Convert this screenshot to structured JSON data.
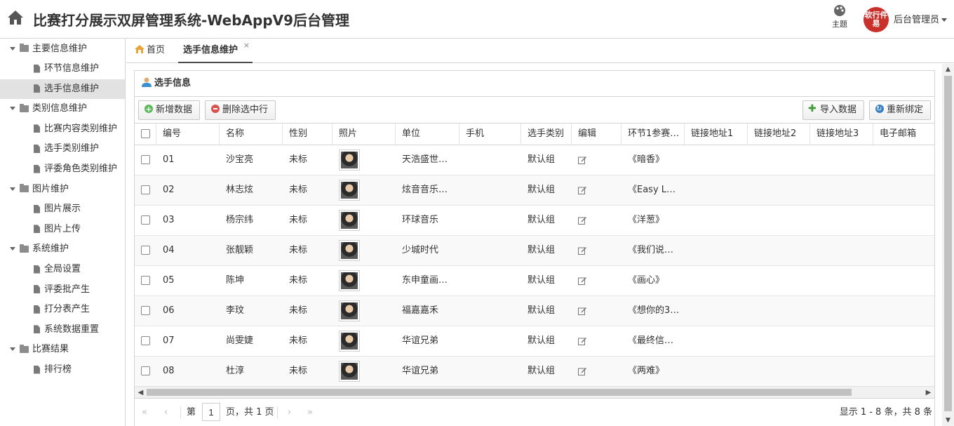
{
  "header": {
    "title": "比赛打分展示双屏管理系统-WebAppV9后台管理",
    "theme_label": "主题",
    "user_name": "后台管理员",
    "avatar_text": "软行件易"
  },
  "sidebar": {
    "groups": [
      {
        "label": "主要信息维护",
        "items": [
          {
            "label": "环节信息维护"
          },
          {
            "label": "选手信息维护",
            "selected": true
          }
        ]
      },
      {
        "label": "类别信息维护",
        "items": [
          {
            "label": "比赛内容类别维护"
          },
          {
            "label": "选手类别维护"
          },
          {
            "label": "评委角色类别维护"
          }
        ]
      },
      {
        "label": "图片维护",
        "items": [
          {
            "label": "图片展示"
          },
          {
            "label": "图片上传"
          }
        ]
      },
      {
        "label": "系统维护",
        "items": [
          {
            "label": "全局设置"
          },
          {
            "label": "评委批产生"
          },
          {
            "label": "打分表产生"
          },
          {
            "label": "系统数据重置"
          }
        ]
      },
      {
        "label": "比赛结果",
        "items": [
          {
            "label": "排行榜"
          }
        ]
      }
    ]
  },
  "tabs": {
    "home": "首页",
    "active": "选手信息维护",
    "close": "×"
  },
  "panel": {
    "title": "选手信息",
    "toolbar": {
      "add": "新增数据",
      "delete": "删除选中行",
      "import": "导入数据",
      "rebind": "重新绑定"
    }
  },
  "grid": {
    "columns": [
      "编号",
      "名称",
      "性别",
      "照片",
      "单位",
      "手机",
      "选手类别",
      "编辑",
      "环节1参赛…",
      "链接地址1",
      "链接地址2",
      "链接地址3",
      "电子邮箱"
    ],
    "rows": [
      {
        "id": "01",
        "name": "沙宝亮",
        "gender": "未标",
        "unit": "天浩盛世…",
        "phone": "",
        "category": "默认组",
        "stage1": "《暗香》"
      },
      {
        "id": "02",
        "name": "林志炫",
        "gender": "未标",
        "unit": "炫音音乐…",
        "phone": "",
        "category": "默认组",
        "stage1": "《Easy L…"
      },
      {
        "id": "03",
        "name": "杨宗纬",
        "gender": "未标",
        "unit": "环球音乐",
        "phone": "",
        "category": "默认组",
        "stage1": "《洋葱》"
      },
      {
        "id": "04",
        "name": "张靓颖",
        "gender": "未标",
        "unit": "少城时代",
        "phone": "",
        "category": "默认组",
        "stage1": "《我们说…"
      },
      {
        "id": "05",
        "name": "陈坤",
        "gender": "未标",
        "unit": "东申童画…",
        "phone": "",
        "category": "默认组",
        "stage1": "《画心》"
      },
      {
        "id": "06",
        "name": "李玟",
        "gender": "未标",
        "unit": "福嘉嘉禾",
        "phone": "",
        "category": "默认组",
        "stage1": "《想你的3…"
      },
      {
        "id": "07",
        "name": "尚雯婕",
        "gender": "未标",
        "unit": "华谊兄弟",
        "phone": "",
        "category": "默认组",
        "stage1": "《最终信…"
      },
      {
        "id": "08",
        "name": "杜淳",
        "gender": "未标",
        "unit": "华谊兄弟",
        "phone": "",
        "category": "默认组",
        "stage1": "《两难》"
      }
    ]
  },
  "pager": {
    "page_prefix": "第",
    "page_value": "1",
    "page_suffix": "页，共 1 页",
    "info": "显示 1 - 8 条，共 8 条"
  },
  "colors": {
    "border": "#d4d4d4",
    "selected_bg": "#e2e2e2",
    "add_icon": "#5cb85c",
    "delete_icon": "#d9534f",
    "avatar": "#c9302c"
  }
}
